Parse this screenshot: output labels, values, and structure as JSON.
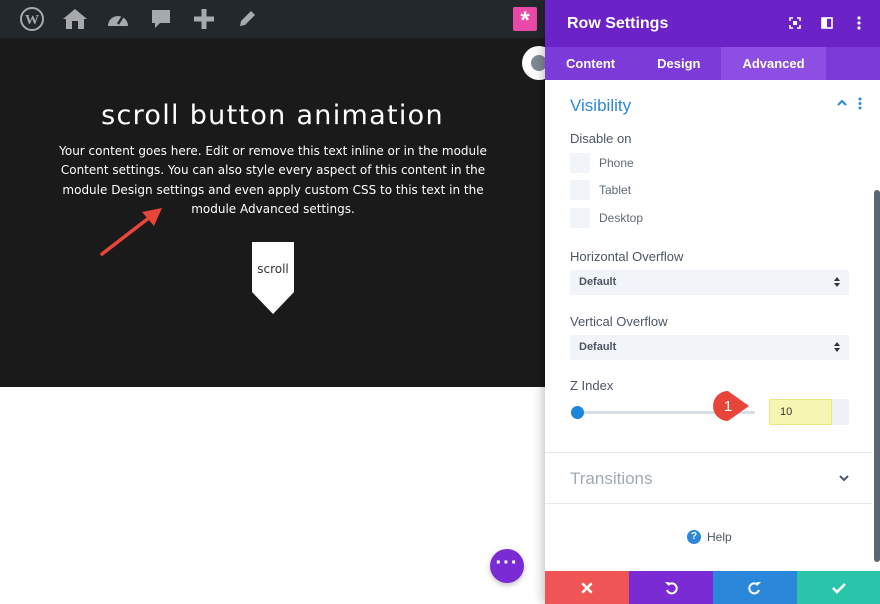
{
  "toolbar": {
    "icons": [
      "wordpress-logo-icon",
      "home-icon",
      "dashboard-gauge-icon",
      "comment-icon",
      "plus-icon",
      "edit-pencil-icon"
    ],
    "builder_icon": "divi-asterisk-icon"
  },
  "hero": {
    "title": "scroll button animation",
    "body": "Your content goes here. Edit or remove this text inline or in the module Content settings. You can also style every aspect of this content in the module Design settings and even apply custom CSS to this text in the module Advanced settings.",
    "scroll_label": "scroll"
  },
  "panel": {
    "title": "Row Settings",
    "tabs": [
      {
        "label": "Content"
      },
      {
        "label": "Design"
      },
      {
        "label": "Advanced"
      }
    ],
    "active_tab": "Advanced",
    "visibility": {
      "title": "Visibility",
      "disable_on_label": "Disable on",
      "options": [
        {
          "label": "Phone",
          "checked": false
        },
        {
          "label": "Tablet",
          "checked": false
        },
        {
          "label": "Desktop",
          "checked": false
        }
      ],
      "horizontal_overflow": {
        "label": "Horizontal Overflow",
        "value": "Default"
      },
      "vertical_overflow": {
        "label": "Vertical Overflow",
        "value": "Default"
      },
      "z_index": {
        "label": "Z Index",
        "value": "10"
      }
    },
    "annotation_number": "1",
    "transitions_title": "Transitions",
    "help_label": "Help",
    "help_icon_glyph": "?"
  },
  "colors": {
    "header_purple": "#6b22c6",
    "tab_purple": "#7c3ad8",
    "accent_blue": "#2b87da",
    "cancel_red": "#ef5555",
    "save_green": "#29c4a9",
    "highlight_yellow": "#f6f5b1"
  }
}
